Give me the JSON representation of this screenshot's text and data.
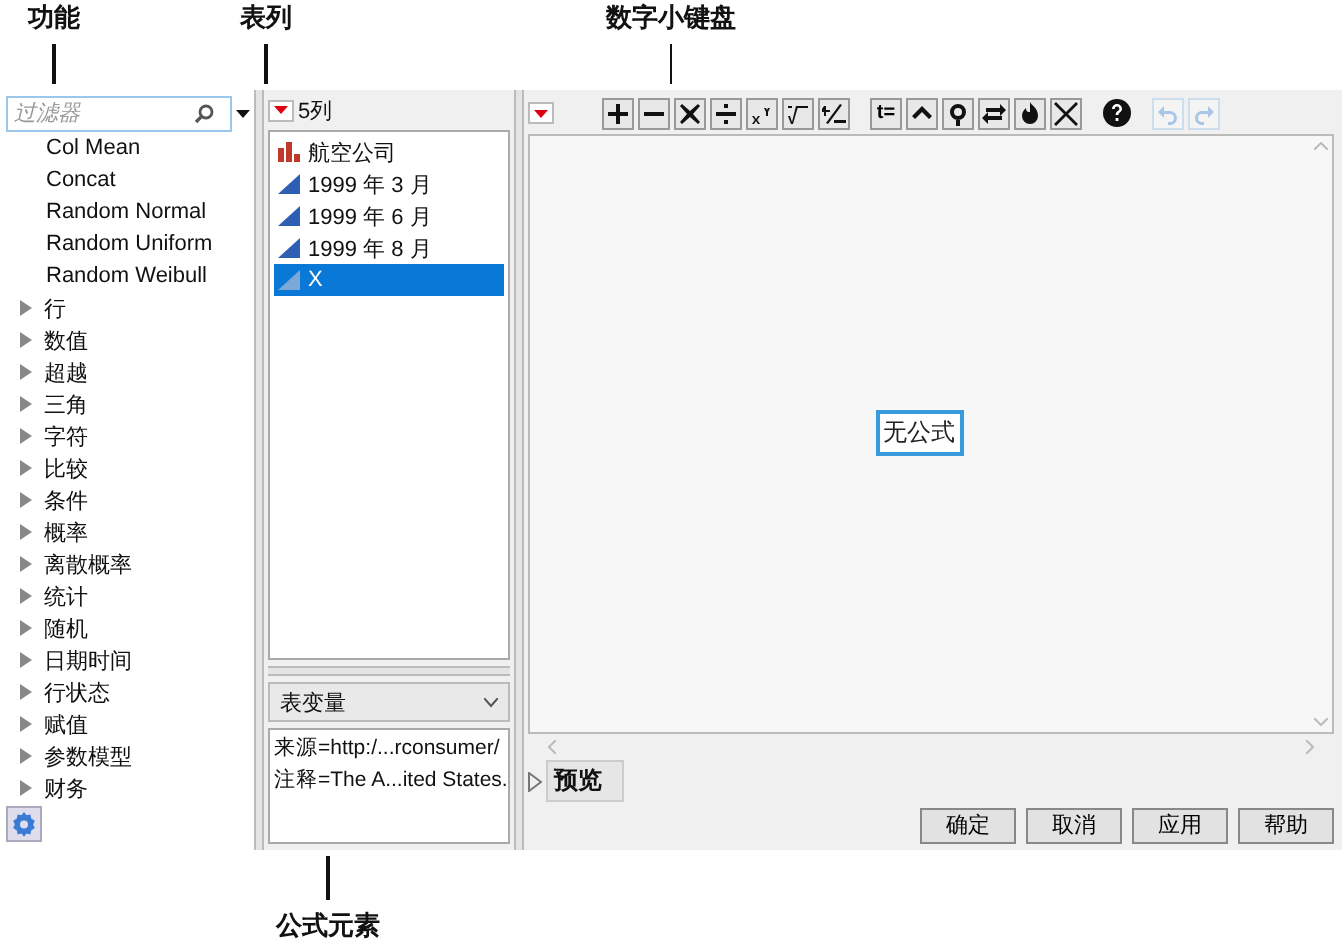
{
  "callouts_top": [
    "功能",
    "表列",
    "数字小键盘"
  ],
  "callouts_bottom": [
    "公式元素"
  ],
  "functions": {
    "filter": {
      "placeholder": "过滤器"
    },
    "items": [
      {
        "label": "Col Mean",
        "kind": "function"
      },
      {
        "label": "Concat",
        "kind": "function"
      },
      {
        "label": "Random Normal",
        "kind": "function"
      },
      {
        "label": "Random Uniform",
        "kind": "function"
      },
      {
        "label": "Random Weibull",
        "kind": "function"
      },
      {
        "label": "行",
        "kind": "category",
        "expanded": false
      },
      {
        "label": "数值",
        "kind": "category",
        "expanded": false
      },
      {
        "label": "超越",
        "kind": "category",
        "expanded": false
      },
      {
        "label": "三角",
        "kind": "category",
        "expanded": false
      },
      {
        "label": "字符",
        "kind": "category",
        "expanded": false
      },
      {
        "label": "比较",
        "kind": "category",
        "expanded": false
      },
      {
        "label": "条件",
        "kind": "category",
        "expanded": false
      },
      {
        "label": "概率",
        "kind": "category",
        "expanded": false
      },
      {
        "label": "离散概率",
        "kind": "category",
        "expanded": false
      },
      {
        "label": "统计",
        "kind": "category",
        "expanded": false
      },
      {
        "label": "随机",
        "kind": "category",
        "expanded": false
      },
      {
        "label": "日期时间",
        "kind": "category",
        "expanded": false
      },
      {
        "label": "行状态",
        "kind": "category",
        "expanded": false
      },
      {
        "label": "赋值",
        "kind": "category",
        "expanded": false
      },
      {
        "label": "参数模型",
        "kind": "category",
        "expanded": false
      },
      {
        "label": "财务",
        "kind": "category",
        "expanded": false
      }
    ]
  },
  "columns": {
    "count_label": "5列",
    "items": [
      {
        "label": "航空公司",
        "kind": "nominal",
        "selected": false
      },
      {
        "label": "1999 年 3 月",
        "kind": "continuous",
        "selected": false
      },
      {
        "label": "1999 年 6 月",
        "kind": "continuous",
        "selected": false
      },
      {
        "label": "1999 年 8 月",
        "kind": "continuous",
        "selected": false
      },
      {
        "label": "X",
        "kind": "continuous",
        "selected": true
      }
    ]
  },
  "elements": {
    "dropdown": "表变量",
    "lines": [
      "来源=http:/...rconsumer/",
      "注释=The A...ited States."
    ]
  },
  "keypad": {
    "text_key": "t=",
    "undo": {
      "disabled": true
    },
    "redo": {
      "disabled": true
    }
  },
  "formula": {
    "placeholder": "无公式"
  },
  "preview": {
    "label": "预览",
    "expanded": false
  },
  "buttons": [
    "确定",
    "取消",
    "应用",
    "帮助"
  ]
}
